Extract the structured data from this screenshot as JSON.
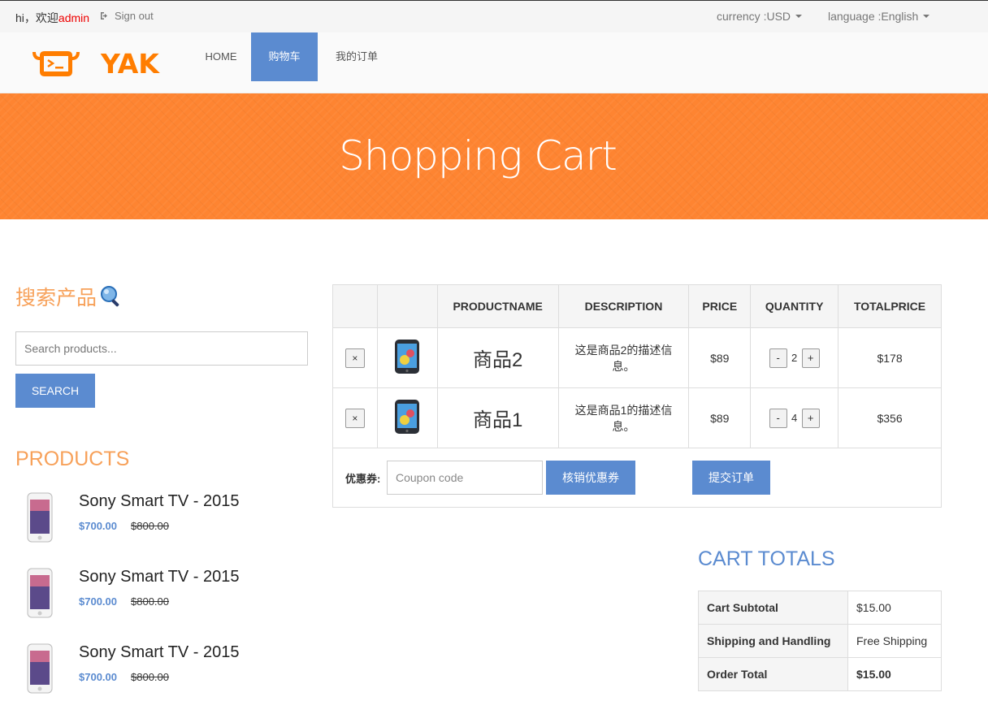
{
  "topbar": {
    "greeting": "hi，欢迎",
    "username": "admin",
    "signout": "Sign out",
    "currency": "currency :USD",
    "language": "language :English"
  },
  "nav": {
    "logo_text": "YAK",
    "items": [
      {
        "label": "HOME",
        "active": false
      },
      {
        "label": "购物车",
        "active": true
      },
      {
        "label": "我的订单",
        "active": false
      }
    ]
  },
  "banner": {
    "title": "Shopping Cart"
  },
  "sidebar": {
    "search_title": "搜索产品",
    "search_placeholder": "Search products...",
    "search_button": "SEARCH",
    "products_title": "PRODUCTS",
    "products": [
      {
        "name": "Sony Smart TV - 2015",
        "price": "$700.00",
        "old_price": "$800.00"
      },
      {
        "name": "Sony Smart TV - 2015",
        "price": "$700.00",
        "old_price": "$800.00"
      },
      {
        "name": "Sony Smart TV - 2015",
        "price": "$700.00",
        "old_price": "$800.00"
      }
    ]
  },
  "cart": {
    "headers": [
      "",
      "",
      "PRODUCTNAME",
      "DESCRIPTION",
      "PRICE",
      "QUANTITY",
      "TOTALPRICE"
    ],
    "remove_label": "×",
    "minus_label": "-",
    "plus_label": "+",
    "rows": [
      {
        "name": "商品2",
        "description": "这是商品2的描述信息。",
        "price": "$89",
        "quantity": "2",
        "total": "$178"
      },
      {
        "name": "商品1",
        "description": "这是商品1的描述信息。",
        "price": "$89",
        "quantity": "4",
        "total": "$356"
      }
    ],
    "coupon_label": "优惠券:",
    "coupon_placeholder": "Coupon code",
    "coupon_button": "核销优惠券",
    "submit_button": "提交订单"
  },
  "totals": {
    "title": "CART TOTALS",
    "rows": [
      {
        "label": "Cart Subtotal",
        "value": "$15.00"
      },
      {
        "label": "Shipping and Handling",
        "value": "Free Shipping"
      },
      {
        "label": "Order Total",
        "value": "$15.00"
      }
    ]
  },
  "colors": {
    "accent": "#5b8bd0",
    "banner": "#fe8431",
    "heading_orange": "#f7a15a",
    "logo": "#ff7d00"
  }
}
